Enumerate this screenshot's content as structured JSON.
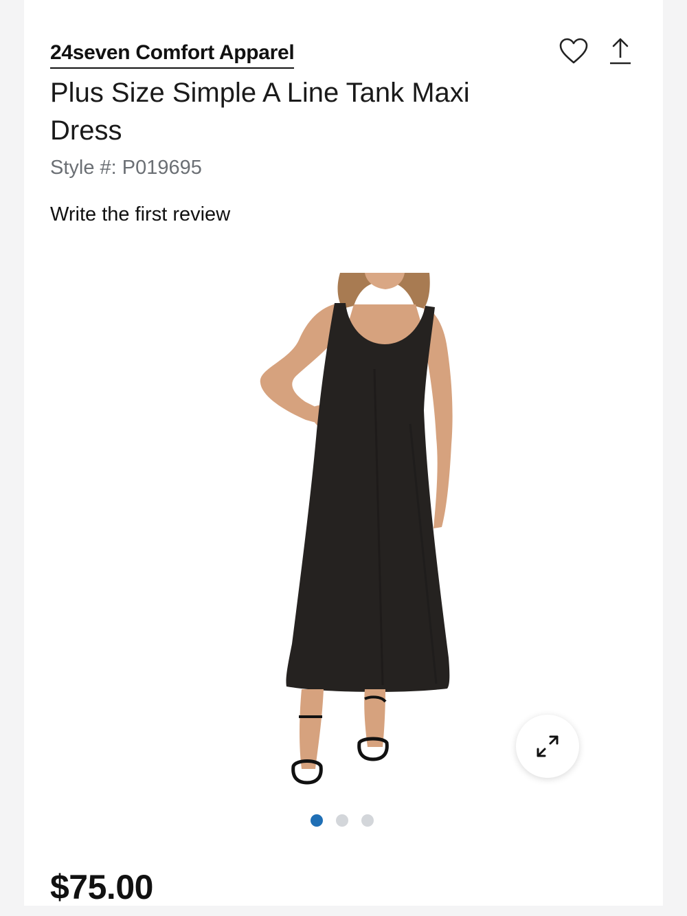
{
  "product": {
    "brand": "24seven Comfort Apparel",
    "title": "Plus Size Simple A Line Tank Maxi Dress",
    "style_label": "Style #: P019695",
    "review_link": "Write the first review",
    "price": "$75.00"
  },
  "actions": {
    "favorite_icon": "heart-outline-icon",
    "share_icon": "share-upload-icon"
  },
  "gallery": {
    "expand_icon": "expand-arrows-icon",
    "slides_count": 3,
    "active_slide": 1,
    "image_alt": "Woman wearing black sleeveless A-line maxi dress with black strappy sandals"
  },
  "colors": {
    "accent_blue": "#1f6fb5",
    "dot_inactive": "#d3d6da",
    "text_muted": "#6b6f74"
  }
}
